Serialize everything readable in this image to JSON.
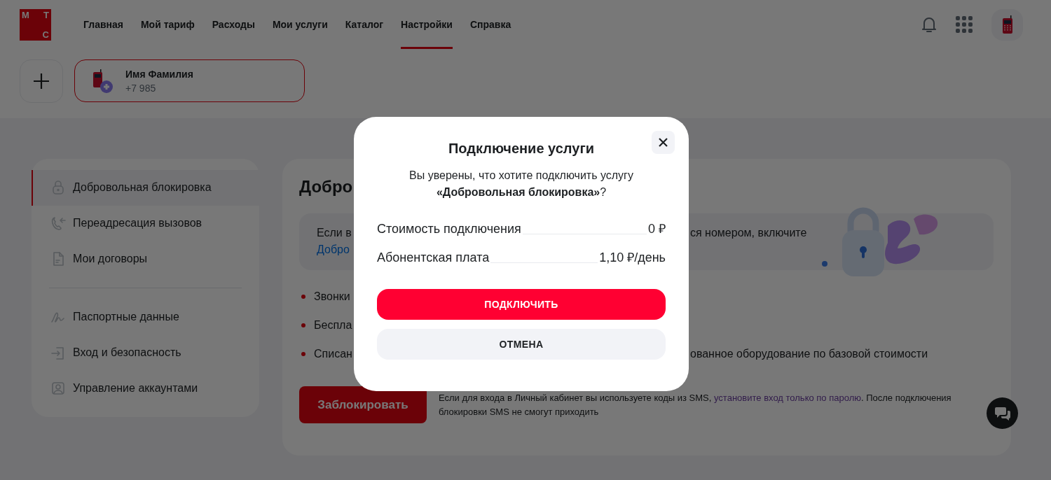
{
  "header": {
    "logo_letters": [
      "М",
      "Т",
      "С"
    ],
    "nav": [
      {
        "label": "Главная",
        "selected": false
      },
      {
        "label": "Мой тариф",
        "selected": false
      },
      {
        "label": "Расходы",
        "selected": false
      },
      {
        "label": "Мои услуги",
        "selected": false
      },
      {
        "label": "Каталог",
        "selected": false
      },
      {
        "label": "Настройки",
        "selected": true
      },
      {
        "label": "Справка",
        "selected": false
      }
    ]
  },
  "account": {
    "name": "Имя Фамилия",
    "phone": "+7 985"
  },
  "sidebar": {
    "groups": [
      [
        {
          "label": "Добровольная блокировка",
          "selected": true
        },
        {
          "label": "Переадресация вызовов",
          "selected": false
        },
        {
          "label": "Мои договоры",
          "selected": false
        }
      ],
      [
        {
          "label": "Паспортные данные",
          "selected": false
        },
        {
          "label": "Вход и безопасность",
          "selected": false
        },
        {
          "label": "Управление аккаунтами",
          "selected": false
        }
      ]
    ]
  },
  "main": {
    "title": "Добро",
    "info": {
      "text_left": "Если в",
      "text_right": "ся номером, включите",
      "link": "Добро"
    },
    "bullets": [
      {
        "left": "Звонки"
      },
      {
        "left": "Беспла"
      },
      {
        "left": "Списан",
        "right": "ованное оборудование по базовой стоимости"
      }
    ],
    "block_button": "Заблокировать",
    "note": {
      "before": "Если для входа в Личный кабинет вы используете коды из SMS, ",
      "link": "установите вход только по паролю",
      "after": ". После подключения блокировки SMS не смогут приходить"
    }
  },
  "modal": {
    "title": "Подключение услуги",
    "question": "Вы уверены, что хотите подключить услугу **«Добровольная блокировка»**?",
    "prices": [
      {
        "label": "Стоимость подключения",
        "value": "0 ₽"
      },
      {
        "label": "Абонентская плата",
        "value": "1,10 ₽/день"
      }
    ],
    "confirm": "ПОДКЛЮЧИТЬ",
    "cancel": "ОТМЕНА"
  }
}
